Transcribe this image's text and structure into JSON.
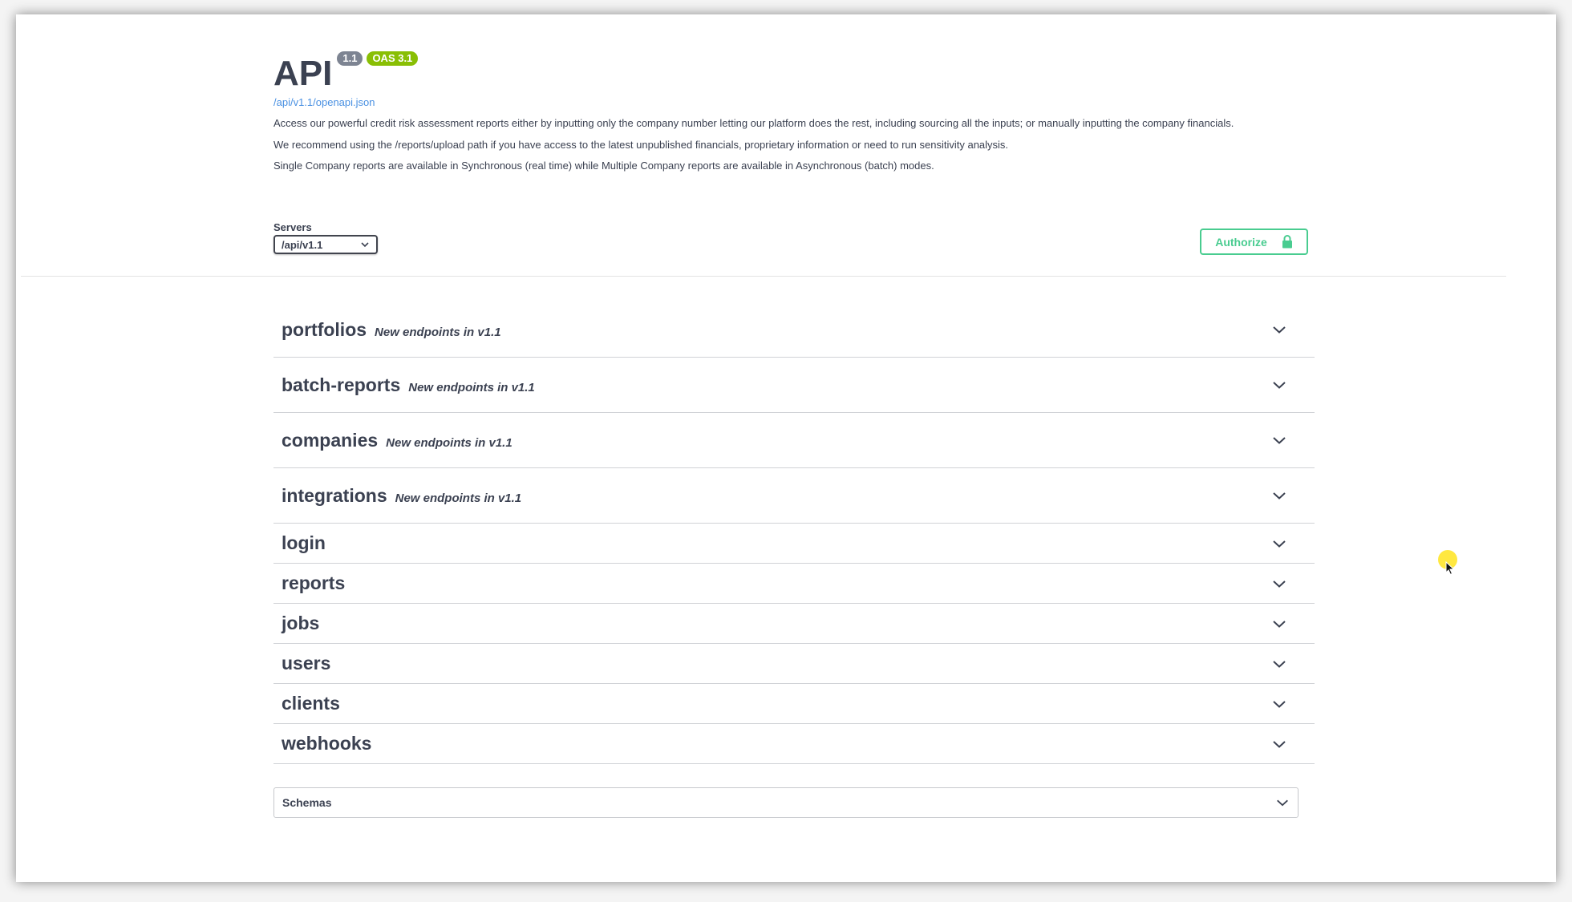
{
  "info": {
    "title": "API",
    "version_badge": "1.1",
    "oas_badge": "OAS 3.1",
    "spec_link": "/api/v1.1/openapi.json",
    "description": [
      "Access our powerful credit risk assessment reports either by inputting only the company number letting our platform does the rest, including sourcing all the inputs; or manually inputting the company financials.",
      "We recommend using the /reports/upload path if you have access to the latest unpublished financials, proprietary information or need to run sensitivity analysis.",
      "Single Company reports are available in Synchronous (real time) while Multiple Company reports are available in Asynchronous (batch) modes."
    ]
  },
  "servers": {
    "label": "Servers",
    "selected": "/api/v1.1"
  },
  "authorize": {
    "label": "Authorize",
    "icon": "lock-icon"
  },
  "tags": [
    {
      "name": "portfolios",
      "description": "New endpoints in v1.1"
    },
    {
      "name": "batch-reports",
      "description": "New endpoints in v1.1"
    },
    {
      "name": "companies",
      "description": "New endpoints in v1.1"
    },
    {
      "name": "integrations",
      "description": "New endpoints in v1.1"
    },
    {
      "name": "login",
      "description": ""
    },
    {
      "name": "reports",
      "description": ""
    },
    {
      "name": "jobs",
      "description": ""
    },
    {
      "name": "users",
      "description": ""
    },
    {
      "name": "clients",
      "description": ""
    },
    {
      "name": "webhooks",
      "description": ""
    }
  ],
  "schemas": {
    "label": "Schemas"
  },
  "colors": {
    "accent_green": "#49cc90",
    "oas_badge": "#89bf04",
    "version_badge": "#7d8492",
    "link": "#4990e2",
    "text": "#3b4151"
  }
}
